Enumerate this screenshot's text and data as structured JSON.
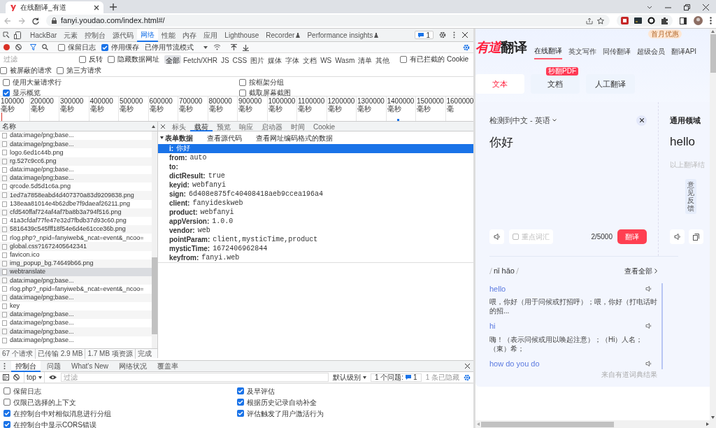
{
  "browser": {
    "tab_title": "在线翻译_有道",
    "address": "fanyi.youdao.com/index.html#/"
  },
  "devtools": {
    "tabs": [
      {
        "label": "HackBar",
        "selected": false
      },
      {
        "label": "元素",
        "selected": false
      },
      {
        "label": "控制台",
        "selected": false
      },
      {
        "label": "源代码",
        "selected": false
      },
      {
        "label": "网络",
        "selected": true
      },
      {
        "label": "性能",
        "selected": false
      },
      {
        "label": "内存",
        "selected": false
      },
      {
        "label": "应用",
        "selected": false
      },
      {
        "label": "Lighthouse",
        "selected": false
      },
      {
        "label": "Recorder",
        "selected": false
      },
      {
        "label": "Performance insights",
        "selected": false
      }
    ],
    "issues_count": "1",
    "network_toolbar": {
      "preserve_log": {
        "label": "保留日志",
        "checked": false
      },
      "disable_cache": {
        "label": "停用缓存",
        "checked": true
      },
      "throttling": "已停用节流模式"
    },
    "filter": {
      "placeholder": "过滤",
      "invert": {
        "label": "反转",
        "checked": false
      },
      "hide_data_urls": {
        "label": "隐藏数据网址",
        "checked": false
      },
      "types": [
        {
          "label": "全部",
          "selected": true
        },
        {
          "label": "Fetch/XHR",
          "selected": false
        },
        {
          "label": "JS",
          "selected": false
        },
        {
          "label": "CSS",
          "selected": false
        },
        {
          "label": "图片",
          "selected": false
        },
        {
          "label": "媒体",
          "selected": false
        },
        {
          "label": "字体",
          "selected": false
        },
        {
          "label": "文档",
          "selected": false
        },
        {
          "label": "WS",
          "selected": false
        },
        {
          "label": "Wasm",
          "selected": false
        },
        {
          "label": "清单",
          "selected": false
        },
        {
          "label": "其他",
          "selected": false
        }
      ],
      "blocked_cookies": {
        "label": "有已拦截的 Cookie",
        "checked": false
      },
      "blocked_requests": {
        "label": "被屏蔽的请求",
        "checked": false
      },
      "third_party": {
        "label": "第三方请求",
        "checked": false
      }
    },
    "options": [
      {
        "label": "使用大量请求行",
        "checked": false
      },
      {
        "label": "按框架分组",
        "checked": false
      },
      {
        "label": "显示概览",
        "checked": true
      },
      {
        "label": "截取屏幕截图",
        "checked": false
      }
    ],
    "timeline_ticks": [
      "100000 毫秒",
      "200000 毫秒",
      "300000 毫秒",
      "400000 毫秒",
      "500000 毫秒",
      "600000 毫秒",
      "700000 毫秒",
      "800000 毫秒",
      "900000 毫秒",
      "1000000 毫秒",
      "1100000 毫秒",
      "1200000 毫秒",
      "1300000 毫秒",
      "1400000 毫秒",
      "1500000 毫秒",
      "1600000 毫"
    ],
    "requests": {
      "column": "名称",
      "rows": [
        {
          "name": "data:image/png;base...",
          "selected": false
        },
        {
          "name": "data:image/png;base...",
          "selected": false
        },
        {
          "name": "logo.6ed1c44b.png",
          "selected": false
        },
        {
          "name": "rg.527c9cc6.png",
          "selected": false
        },
        {
          "name": "data:image/png;base...",
          "selected": false
        },
        {
          "name": "data:image/png;base...",
          "selected": false
        },
        {
          "name": "qrcode.5d5d1c6a.png",
          "selected": false
        },
        {
          "name": "1ed7a7858eabd4d407370a83d9209838.png",
          "selected": false
        },
        {
          "name": "138eaa81014e4b62dbe7f9daeaf26211.png",
          "selected": false
        },
        {
          "name": "cfd540ffaf724af4af7ba8b3a794f516.png",
          "selected": false
        },
        {
          "name": "41a3cfdaf77fe47e32d7fbdb37d93c60.png",
          "selected": false
        },
        {
          "name": "5816439c545fff18f54e6d4e61cce36b.png",
          "selected": false
        },
        {
          "name": "rlog.php?_npid=fanyiweb&_ncat=event&_ncoo=",
          "selected": false
        },
        {
          "name": "global.css?1672405642341",
          "selected": false
        },
        {
          "name": "favicon.ico",
          "selected": false
        },
        {
          "name": "img_popup_bg.74649b66.png",
          "selected": false
        },
        {
          "name": "webtranslate",
          "selected": true
        },
        {
          "name": "data:image/png;base...",
          "selected": false
        },
        {
          "name": "rlog.php?_npid=fanyiweb&_ncat=event&_ncoo=",
          "selected": false
        },
        {
          "name": "data:image/png;base...",
          "selected": false
        },
        {
          "name": "key",
          "selected": false
        },
        {
          "name": "data:image/png;base...",
          "selected": false
        },
        {
          "name": "data:image/png;base...",
          "selected": false
        },
        {
          "name": "data:image/png;base...",
          "selected": false
        },
        {
          "name": "data:image/png;base...",
          "selected": false
        }
      ]
    },
    "summary": [
      "67 个请求",
      "已传输 2.9 MB",
      "1.7 MB 项资源",
      "完成"
    ],
    "detail_tabs": [
      {
        "label": "标头",
        "selected": false
      },
      {
        "label": "载荷",
        "selected": true
      },
      {
        "label": "预览",
        "selected": false
      },
      {
        "label": "响应",
        "selected": false
      },
      {
        "label": "启动器",
        "selected": false
      },
      {
        "label": "时间",
        "selected": false
      },
      {
        "label": "Cookie",
        "selected": false
      }
    ],
    "payload": {
      "section": "表单数据",
      "links": [
        "查看源代码",
        "查看网址编码格式的数据"
      ],
      "fields": [
        {
          "key": "i:",
          "value": "你好",
          "selected": true
        },
        {
          "key": "from:",
          "value": "auto",
          "selected": false
        },
        {
          "key": "to:",
          "selected": false
        },
        {
          "key": "dictResult:",
          "value": "true",
          "selected": false
        },
        {
          "key": "keyid:",
          "value": "webfanyi",
          "selected": false
        },
        {
          "key": "sign:",
          "value": "6d408e875fc40408418aeb9ccea196a4",
          "selected": false
        },
        {
          "key": "client:",
          "value": "fanyideskweb",
          "selected": false
        },
        {
          "key": "product:",
          "value": "webfanyi",
          "selected": false
        },
        {
          "key": "appVersion:",
          "value": "1.0.0",
          "selected": false
        },
        {
          "key": "vendor:",
          "value": "web",
          "selected": false
        },
        {
          "key": "pointParam:",
          "value": "client,mysticTime,product",
          "selected": false
        },
        {
          "key": "mysticTime:",
          "value": "1672406962844",
          "selected": false
        },
        {
          "key": "keyfrom:",
          "value": "fanyi.web",
          "selected": false
        }
      ]
    },
    "drawer": {
      "tabs": [
        {
          "label": "控制台",
          "selected": true
        },
        {
          "label": "问题",
          "selected": false
        },
        {
          "label": "What's New",
          "selected": false
        },
        {
          "label": "网络状况",
          "selected": false
        },
        {
          "label": "覆盖率",
          "selected": false
        }
      ],
      "context": "top",
      "filter_placeholder": "过滤",
      "level": "默认级别",
      "issues_label": "1 个问题:",
      "issues_count": "1",
      "hidden": "1 条已隐藏",
      "settings_left": [
        {
          "label": "保留日志",
          "checked": false
        },
        {
          "label": "仅限已选择的上下文",
          "checked": false
        },
        {
          "label": "在控制台中对相似消息进行分组",
          "checked": true
        },
        {
          "label": "在控制台中显示CORS错误",
          "checked": true
        }
      ],
      "settings_right": [
        {
          "label": "及早评估",
          "checked": true
        },
        {
          "label": "根据历史记录自动补全",
          "checked": true
        },
        {
          "label": "评估触发了用户激活行为",
          "checked": true
        }
      ]
    }
  },
  "page": {
    "logo_brand": "有道",
    "logo_product": "翻译",
    "nav": [
      {
        "label": "在线翻译",
        "selected": true
      },
      {
        "label": "英文写作",
        "selected": false
      },
      {
        "label": "同传翻译",
        "selected": false
      },
      {
        "label": "超级会员",
        "selected": false,
        "badge": "首月优惠"
      },
      {
        "label": "翻译API",
        "selected": false
      }
    ],
    "modes": [
      {
        "label": "文本",
        "selected": true
      },
      {
        "label": "文档",
        "selected": false,
        "badge": "秒翻PDF"
      },
      {
        "label": "人工翻译",
        "selected": false
      }
    ],
    "language": "检测到中文 - 英语",
    "source_text": "你好",
    "domain": "通用领域",
    "result": "hello",
    "result_note": "以上翻译结",
    "feedback": "意见反馈",
    "key_vocab": {
      "label": "重点词汇",
      "checked": false
    },
    "char_count": "2/5000",
    "translate_button": "翻译",
    "pinyin": "nǐ hǎo",
    "view_all": "查看全部",
    "dict_entries": [
      {
        "word": "hello",
        "meaning": "喂，你好（用于问候或打招呼）；喂，你好（打电话时的招..."
      },
      {
        "word": "hi",
        "meaning": "嗨！（表示问候或用以唤起注意）；（Hi）人名；（東）希；"
      },
      {
        "word": "how do you do"
      }
    ],
    "dict_source": "来自有道词典结果"
  }
}
